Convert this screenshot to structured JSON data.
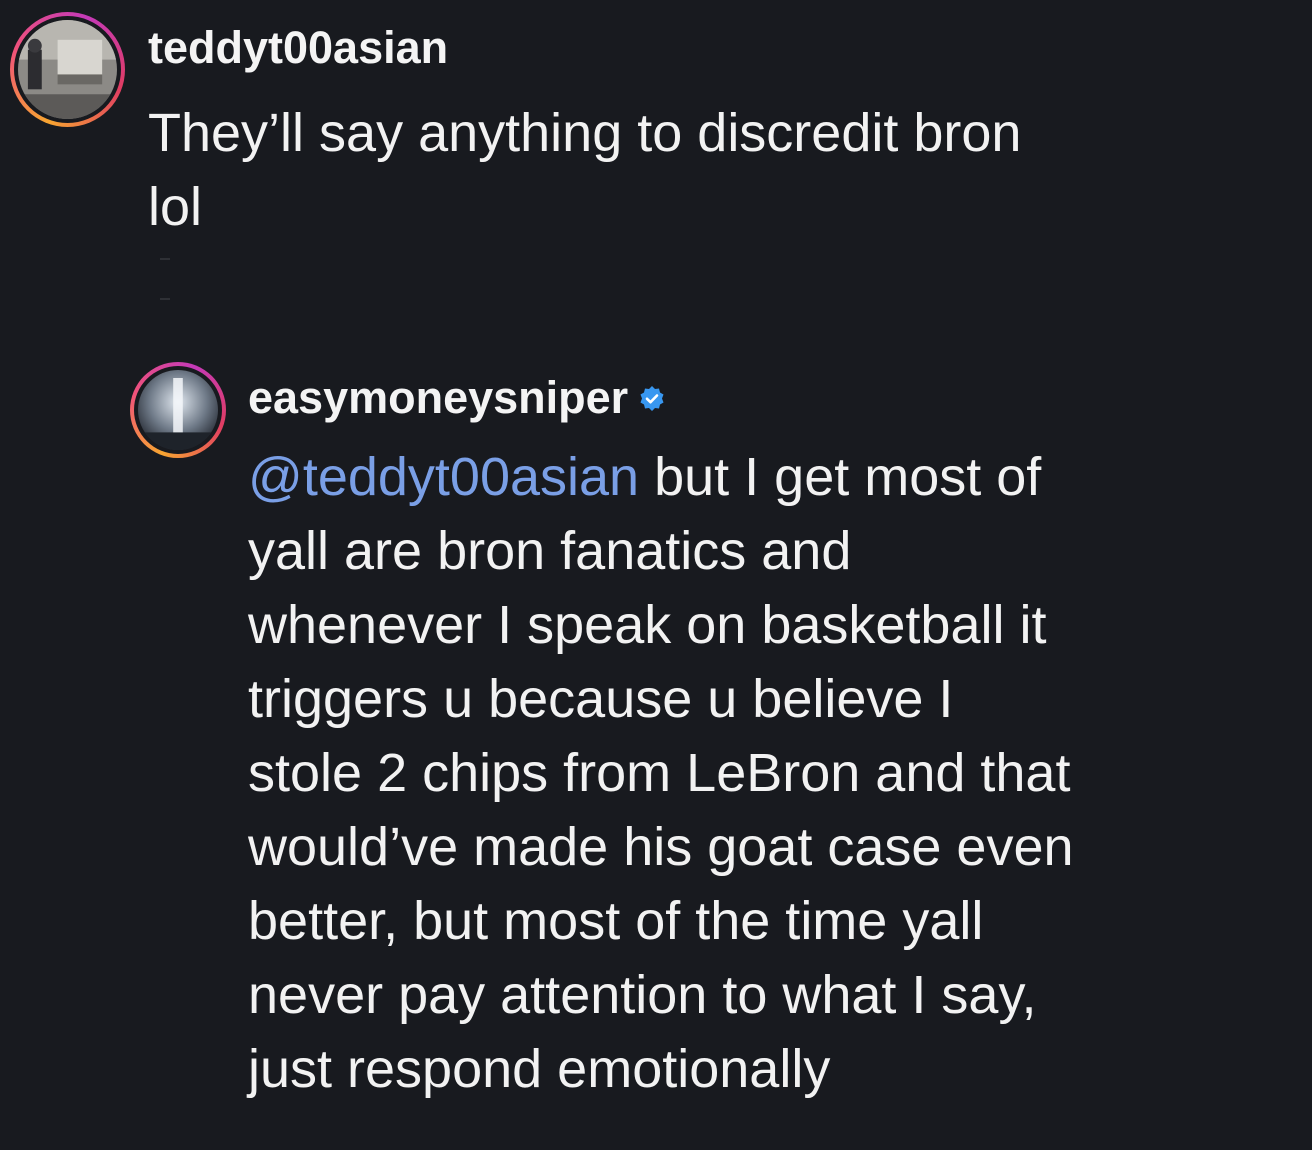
{
  "comments": [
    {
      "username": "teddyt00asian",
      "text_lines": [
        "They’ll say anything to discredit bron",
        "lol"
      ]
    }
  ],
  "reply": {
    "username": "easymoneysniper",
    "verified": true,
    "mention": "@teddyt00asian",
    "text_first": " but I get most of",
    "text_lines": [
      "yall are bron fanatics and",
      "whenever I speak on basketball it",
      "triggers u because u believe I",
      "stole 2 chips from LeBron and that",
      "would’ve made his goat case even",
      "better, but most of the time yall",
      "never pay attention to what I say,",
      "just respond emotionally"
    ]
  },
  "colors": {
    "background": "#181a1f",
    "mention": "#7a9fe6",
    "verified_badge": "#3897f0",
    "story_ring": [
      "#f7a531",
      "#f0527a",
      "#c43ab8"
    ]
  },
  "icons": {
    "verified": "verified-badge-icon"
  }
}
